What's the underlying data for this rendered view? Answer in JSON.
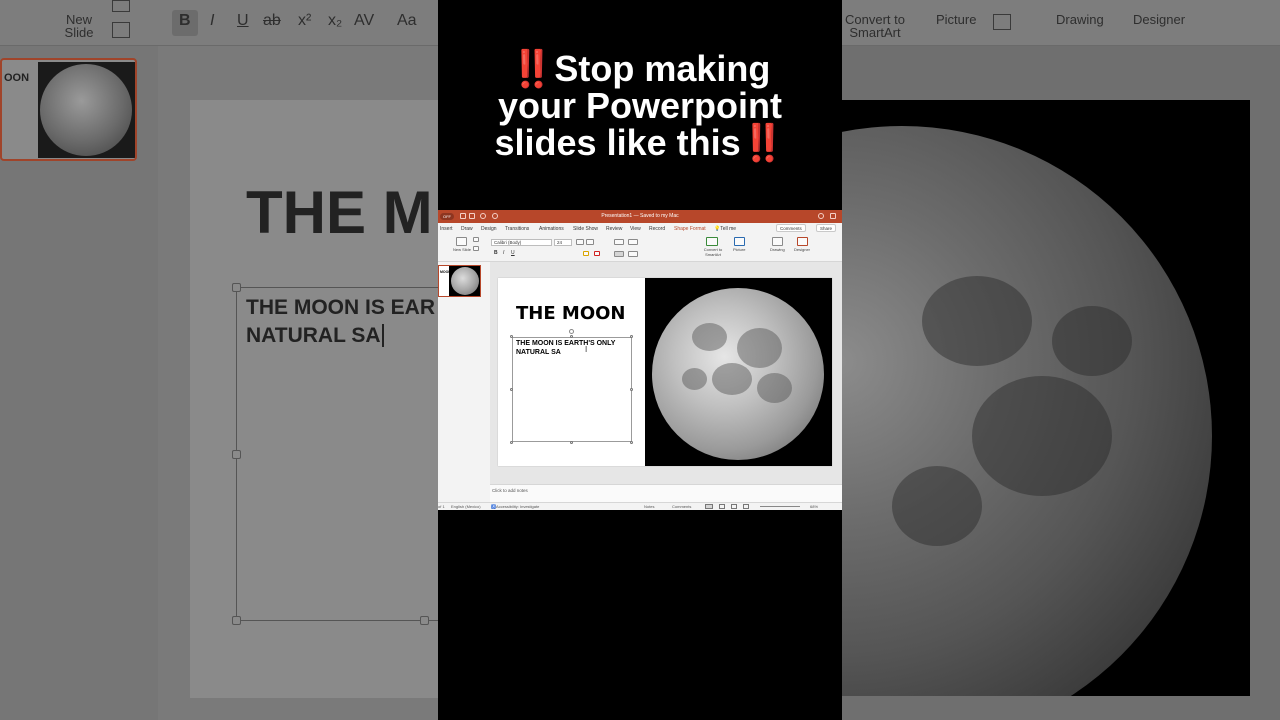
{
  "headline": {
    "line1_prefix": "‼️",
    "line1": "Stop making",
    "line2": "your Powerpoint",
    "line3": "slides like this",
    "line3_suffix": "‼️"
  },
  "background_left": {
    "ribbon": {
      "new_slide_line1": "New",
      "new_slide_line2": "Slide",
      "bold": "B",
      "italic": "I",
      "underline": "U",
      "strike": "ab",
      "superscript": "x²",
      "subscript": "x₂",
      "spacing": "AV",
      "case": "Aa"
    },
    "thumb_title": "OON",
    "slide_title": "THE M",
    "slide_body_line1": "THE MOON IS EAR",
    "slide_body_line2": "NATURAL SA"
  },
  "background_right": {
    "ribbon": {
      "convert_line1": "Convert to",
      "convert_line2": "SmartArt",
      "picture": "Picture",
      "drawing": "Drawing",
      "designer": "Designer"
    }
  },
  "ppt": {
    "autosave": "OFF",
    "doc_title": "Presentation1 — Saved to my Mac",
    "tabs": [
      "Insert",
      "Draw",
      "Design",
      "Transitions",
      "Animations",
      "Slide Show",
      "Review",
      "View",
      "Record",
      "Shape Format",
      "Tell me"
    ],
    "comments": "Comments",
    "share": "Share",
    "ribbon": {
      "new_slide": "New Slide",
      "font_name": "Calibri (Body)",
      "font_size": "24",
      "convert": "Convert to SmartArt",
      "picture": "Picture",
      "drawing": "Drawing",
      "designer": "Designer",
      "bold": "B",
      "italic": "I",
      "underline": "U"
    },
    "thumb_title": "MOON",
    "slide_title": "THE MOON",
    "slide_body": "THE MOON IS EARTH'S ONLY NATURAL SA",
    "notes_placeholder": "Click to add notes",
    "status": {
      "slide": "of 1",
      "language": "English (Mexico)",
      "accessibility": "Accessibility: Investigate",
      "notes": "Notes",
      "comments": "Comments",
      "zoom": "68%"
    }
  },
  "colors": {
    "accent": "#b7472a",
    "headline_emoji": "#e0141a"
  }
}
